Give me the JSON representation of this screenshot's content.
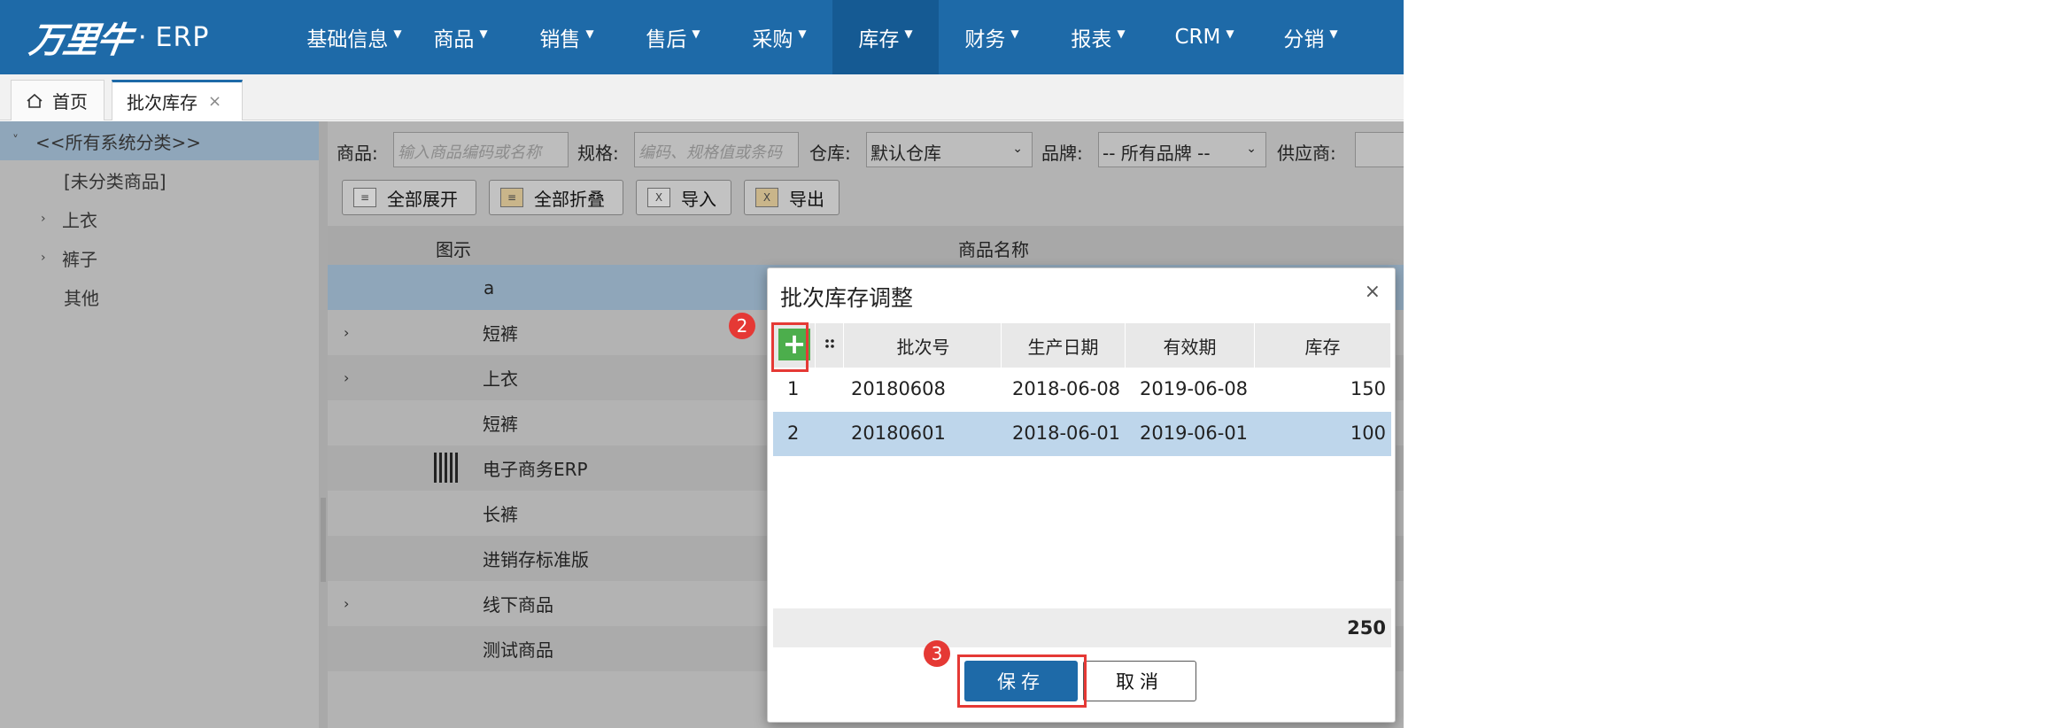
{
  "header": {
    "logo_mark": "万里牛",
    "logo_dot": "·",
    "logo_erp": "ERP",
    "nav": [
      "基础信息",
      "商品",
      "销售",
      "售后",
      "采购",
      "库存",
      "财务",
      "报表",
      "CRM",
      "分销"
    ],
    "active_nav": "库存",
    "colors": {
      "topbar": "#1e6aa8",
      "active": "#155a93"
    }
  },
  "tabs": [
    {
      "label": "首页",
      "icon": "home-icon"
    },
    {
      "label": "批次库存",
      "close": "×"
    }
  ],
  "tree": {
    "items": [
      {
        "label": "<<所有系统分类>>",
        "arrow": "˅",
        "selected": true
      },
      {
        "label": "[未分类商品]",
        "arrow": ""
      },
      {
        "label": "上衣",
        "arrow": "›"
      },
      {
        "label": "裤子",
        "arrow": "›"
      },
      {
        "label": "其他",
        "arrow": ""
      }
    ]
  },
  "filters": {
    "product_label": "商品:",
    "product_placeholder": "输入商品编码或名称",
    "spec_label": "规格:",
    "spec_placeholder": "编码、规格值或条码",
    "warehouse_label": "仓库:",
    "warehouse_value": "默认仓库",
    "brand_label": "品牌:",
    "brand_value": "-- 所有品牌 --",
    "supplier_label": "供应商:"
  },
  "toolbar": {
    "expand_all": "全部展开",
    "collapse_all": "全部折叠",
    "import": "导入",
    "export": "导出"
  },
  "grid": {
    "col_image": "图示",
    "col_name": "商品名称",
    "rows": [
      {
        "name": "a",
        "expand": ""
      },
      {
        "name": "短裤",
        "expand": "›"
      },
      {
        "name": "上衣",
        "expand": "›"
      },
      {
        "name": "短裤",
        "expand": ""
      },
      {
        "name": "电子商务ERP",
        "expand": "",
        "has_image": true
      },
      {
        "name": "长裤",
        "expand": ""
      },
      {
        "name": "进销存标准版",
        "expand": ""
      },
      {
        "name": "线下商品",
        "expand": "›"
      },
      {
        "name": "测试商品",
        "expand": ""
      }
    ]
  },
  "dialog": {
    "title": "批次库存调整",
    "close": "×",
    "add": "+",
    "columns": [
      "批次号",
      "生产日期",
      "有效期",
      "库存"
    ],
    "rows": [
      {
        "index": "1",
        "batch": "20180608",
        "mfg_date": "2018-06-08",
        "expiry": "2019-06-08",
        "stock": "150"
      },
      {
        "index": "2",
        "batch": "20180601",
        "mfg_date": "2018-06-01",
        "expiry": "2019-06-01",
        "stock": "100"
      }
    ],
    "total": "250",
    "save": "保存",
    "cancel": "取消",
    "markers": [
      "2",
      "3"
    ]
  }
}
